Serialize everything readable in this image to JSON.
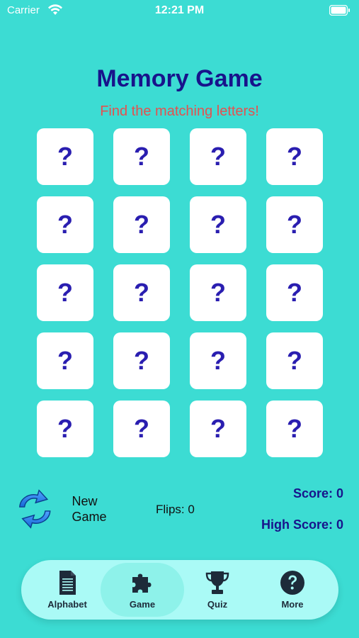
{
  "status": {
    "carrier": "Carrier",
    "time": "12:21 PM"
  },
  "header": {
    "title": "Memory Game",
    "subtitle": "Find the matching letters!"
  },
  "grid": {
    "cards": [
      "?",
      "?",
      "?",
      "?",
      "?",
      "?",
      "?",
      "?",
      "?",
      "?",
      "?",
      "?",
      "?",
      "?",
      "?",
      "?",
      "?",
      "?",
      "?",
      "?"
    ]
  },
  "controls": {
    "new_game_label": "New Game",
    "flips": "Flips: 0",
    "score": "Score: 0",
    "high_score": "High Score: 0"
  },
  "tabs": [
    {
      "label": "Alphabet",
      "icon": "document-icon"
    },
    {
      "label": "Game",
      "icon": "puzzle-icon",
      "active": true
    },
    {
      "label": "Quiz",
      "icon": "trophy-icon"
    },
    {
      "label": "More",
      "icon": "question-circle-icon"
    }
  ],
  "colors": {
    "background": "#3cdcd3",
    "title": "#18138b",
    "subtitle": "#e4514f",
    "card_text": "#2a1eb0",
    "tabbar": "#aafaf6",
    "tab_active": "#8ef2ea"
  }
}
